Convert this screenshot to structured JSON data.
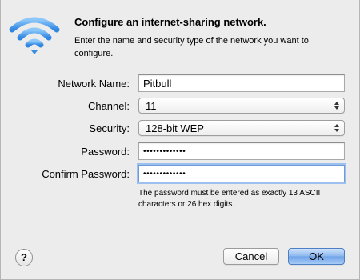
{
  "dialog": {
    "title": "Configure an internet-sharing network.",
    "description": "Enter the name and security type of the network you want to configure.",
    "icon": "wifi-icon"
  },
  "form": {
    "network_name_label": "Network Name:",
    "network_name_value": "Pitbull",
    "channel_label": "Channel:",
    "channel_value": "11",
    "security_label": "Security:",
    "security_value": "128-bit WEP",
    "password_label": "Password:",
    "password_value": "•••••••••••••",
    "confirm_password_label": "Confirm Password:",
    "confirm_password_value": "•••••••••••••",
    "note": "The password must be entered as exactly 13 ASCII characters or 26 hex digits."
  },
  "buttons": {
    "help_label": "?",
    "cancel_label": "Cancel",
    "ok_label": "OK"
  },
  "colors": {
    "wifi_blue": "#4ea3f0",
    "default_button": "#8ab6ee",
    "focus_ring": "#9cc1f0",
    "window_background": "#ececec"
  }
}
